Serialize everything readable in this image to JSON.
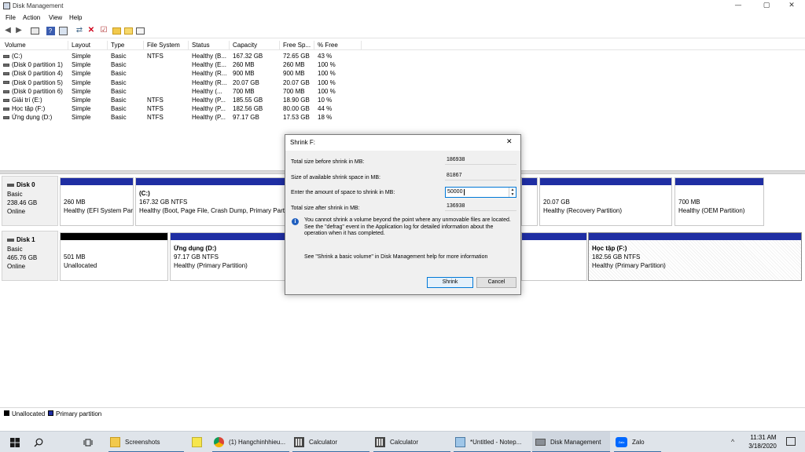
{
  "window": {
    "title": "Disk Management",
    "min": "—",
    "max": "▢",
    "close": "✕"
  },
  "menu": [
    "File",
    "Action",
    "View",
    "Help"
  ],
  "columns": [
    "Volume",
    "Layout",
    "Type",
    "File System",
    "Status",
    "Capacity",
    "Free Sp...",
    "% Free"
  ],
  "volumes": [
    {
      "name": "(C:)",
      "layout": "Simple",
      "type": "Basic",
      "fs": "NTFS",
      "status": "Healthy (B...",
      "capacity": "167.32 GB",
      "free": "72.65 GB",
      "pct": "43 %"
    },
    {
      "name": "(Disk 0 partition 1)",
      "layout": "Simple",
      "type": "Basic",
      "fs": "",
      "status": "Healthy (E...",
      "capacity": "260 MB",
      "free": "260 MB",
      "pct": "100 %"
    },
    {
      "name": "(Disk 0 partition 4)",
      "layout": "Simple",
      "type": "Basic",
      "fs": "",
      "status": "Healthy (R...",
      "capacity": "900 MB",
      "free": "900 MB",
      "pct": "100 %"
    },
    {
      "name": "(Disk 0 partition 5)",
      "layout": "Simple",
      "type": "Basic",
      "fs": "",
      "status": "Healthy (R...",
      "capacity": "20.07 GB",
      "free": "20.07 GB",
      "pct": "100 %"
    },
    {
      "name": "(Disk 0 partition 6)",
      "layout": "Simple",
      "type": "Basic",
      "fs": "",
      "status": "Healthy (...",
      "capacity": "700 MB",
      "free": "700 MB",
      "pct": "100 %"
    },
    {
      "name": "Giải trí (E:)",
      "layout": "Simple",
      "type": "Basic",
      "fs": "NTFS",
      "status": "Healthy (P...",
      "capacity": "185.55 GB",
      "free": "18.90 GB",
      "pct": "10 %"
    },
    {
      "name": "Học tập (F:)",
      "layout": "Simple",
      "type": "Basic",
      "fs": "NTFS",
      "status": "Healthy (P...",
      "capacity": "182.56 GB",
      "free": "80.00 GB",
      "pct": "44 %"
    },
    {
      "name": "Ứng dụng (D:)",
      "layout": "Simple",
      "type": "Basic",
      "fs": "NTFS",
      "status": "Healthy (P...",
      "capacity": "97.17 GB",
      "free": "17.53 GB",
      "pct": "18 %"
    }
  ],
  "disk0": {
    "name": "Disk 0",
    "type": "Basic",
    "size": "238.46 GB",
    "state": "Online",
    "partitions": [
      {
        "title": "",
        "size": "260 MB",
        "status": "Healthy (EFI System Part"
      },
      {
        "title": "(C:)",
        "size": "167.32 GB NTFS",
        "status": "Healthy (Boot, Page File, Crash Dump, Primary Partiti"
      },
      {
        "title": "",
        "size": "20.07 GB",
        "status": "Healthy (Recovery Partition)"
      },
      {
        "title": "",
        "size": "700 MB",
        "status": "Healthy (OEM Partition)"
      }
    ]
  },
  "disk1": {
    "name": "Disk 1",
    "type": "Basic",
    "size": "465.76 GB",
    "state": "Online",
    "partitions": [
      {
        "title": "",
        "size": "501 MB",
        "status": "Unallocated"
      },
      {
        "title": "Ứng dụng  (D:)",
        "size": "97.17 GB NTFS",
        "status": "Healthy (Primary Partition)"
      },
      {
        "title": "Học tập  (F:)",
        "size": "182.56 GB NTFS",
        "status": "Healthy (Primary Partition)"
      }
    ]
  },
  "legend": {
    "unallocated": "Unallocated",
    "primary": "Primary partition"
  },
  "dialog": {
    "title": "Shrink F:",
    "close": "✕",
    "total_label": "Total size before shrink in MB:",
    "total_value": "186938",
    "available_label": "Size of available shrink space in MB:",
    "available_value": "81867",
    "amount_label": "Enter the amount of space to shrink in MB:",
    "amount_value": "50000",
    "after_label": "Total size after shrink in MB:",
    "after_value": "136938",
    "info_text": "You cannot shrink a volume beyond the point where any unmovable files are located. See the \"defrag\" event in the Application log for detailed information about the operation when it has completed.",
    "help_text": "See \"Shrink a basic volume\" in Disk Management help for more information",
    "shrink_button": "Shrink",
    "cancel_button": "Cancel"
  },
  "taskbar": {
    "items": [
      "Screenshots",
      "(1) Hangchinhhieu...",
      "Calculator",
      "Calculator",
      "*Untitled - Notep...",
      "Disk Management",
      "Zalo"
    ],
    "zalo_icon_text": "Zalo",
    "time": "11:31 AM",
    "date": "3/18/2020"
  },
  "colors": {
    "primary": "#1f2ea3",
    "unallocated": "#000000",
    "taskbar": "#dfe4ea"
  },
  "icons": [
    "back-arrow-icon",
    "forward-arrow-icon",
    "windows-icon",
    "search-icon",
    "task-view-icon",
    "folder-icon",
    "sticky-notes-icon",
    "chrome-icon",
    "calculator-icon",
    "notepad-icon",
    "disk-management-icon",
    "zalo-icon",
    "info-icon"
  ]
}
